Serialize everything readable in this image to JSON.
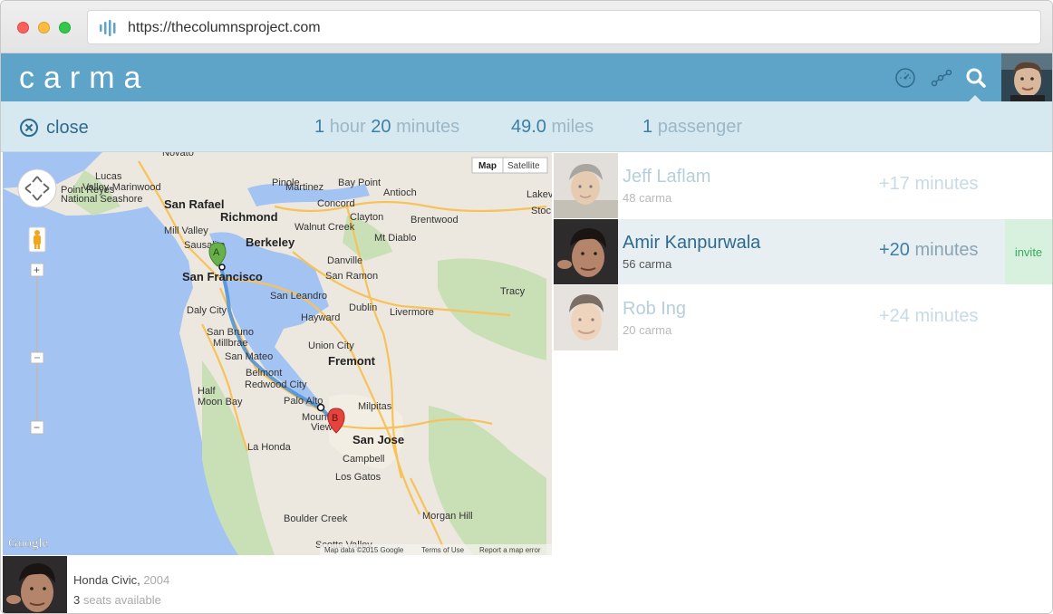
{
  "browser": {
    "url": "https://thecolumnsproject.com"
  },
  "app": {
    "logo": "carma",
    "header_icons": [
      "dashboard-icon",
      "route-icon",
      "search-icon"
    ]
  },
  "trip": {
    "close_label": "close",
    "duration": {
      "hours": "1",
      "hours_unit": "hour",
      "minutes": "20",
      "minutes_unit": "minutes"
    },
    "distance": {
      "value": "49.0",
      "unit": "miles"
    },
    "passengers": {
      "value": "1",
      "unit": "passenger"
    }
  },
  "map": {
    "type_buttons": [
      "Map",
      "Satellite"
    ],
    "attribution": "Map data ©2015 Google",
    "terms": "Terms of Use",
    "report": "Report a map error",
    "brand": "Google",
    "marker_a": "A",
    "marker_b": "B",
    "zoom_in": "+",
    "zoom_out": "−",
    "places": [
      "Novato",
      "Point Reyes National Seashore",
      "Lucas Valley-Marinwood",
      "San Rafael",
      "Mill Valley",
      "Sausalito",
      "San Francisco",
      "Daly City",
      "San Bruno",
      "Millbrae",
      "San Mateo",
      "Half Moon Bay",
      "Belmont",
      "Redwood City",
      "Palo Alto",
      "Mountain View",
      "La Honda",
      "Boulder Creek",
      "Scotts Valley",
      "Pinole",
      "Martinez",
      "Bay Point",
      "Antioch",
      "Richmond",
      "Concord",
      "Clayton",
      "Brentwood",
      "Walnut Creek",
      "Berkeley",
      "Mt Diablo",
      "Danville",
      "San Ramon",
      "San Leandro",
      "Dublin",
      "Livermore",
      "Tracy",
      "Hayward",
      "Union City",
      "Fremont",
      "Milpitas",
      "San Jose",
      "Campbell",
      "Los Gatos",
      "Morgan Hill",
      "Lakeview",
      "Stockton"
    ]
  },
  "riders": [
    {
      "name": "Jeff Laflam",
      "carma": "48 carma",
      "time_num": "+17",
      "time_unit": "minutes",
      "active": false
    },
    {
      "name": "Amir Kanpurwala",
      "carma": "56 carma",
      "time_num": "+20",
      "time_unit": "minutes",
      "active": true,
      "action": "invite"
    },
    {
      "name": "Rob Ing",
      "carma": "20 carma",
      "time_num": "+24",
      "time_unit": "minutes",
      "active": false
    }
  ],
  "driver": {
    "car": "Honda Civic,",
    "year": "2004",
    "seats_num": "3",
    "seats_label": "seats available"
  },
  "colors": {
    "header": "#5ea4c8",
    "trip_bar": "#d6e8f0",
    "invite": "#d8f1de",
    "accent_text": "#2f6b8d"
  }
}
